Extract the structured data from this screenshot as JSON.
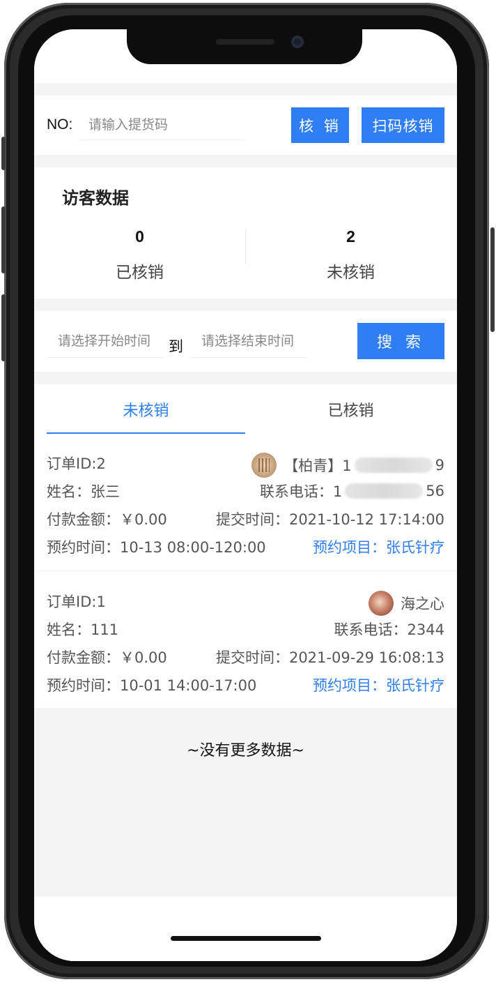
{
  "verify": {
    "no_label": "NO:",
    "code_placeholder": "请输入提货码",
    "verify_button": "核 销",
    "scan_button": "扫码核销"
  },
  "visitor": {
    "title": "访客数据",
    "verified_count": "0",
    "verified_label": "已核销",
    "unverified_count": "2",
    "unverified_label": "未核销"
  },
  "date_filter": {
    "start_placeholder": "请选择开始时间",
    "to_label": "到",
    "end_placeholder": "请选择结束时间",
    "search_button": "搜 索"
  },
  "tabs": {
    "unverified": "未核销",
    "verified": "已核销",
    "active": "unverified"
  },
  "orders": [
    {
      "order_id": "订单ID:2",
      "user_name": "【柏青】1",
      "user_name_tail": "9",
      "name": "姓名：张三",
      "phone_label": "联系电话：1",
      "phone_tail": "56",
      "amount": "付款金额：￥0.00",
      "submit_time": "提交时间：2021-10-12 17:14:00",
      "booking_time": "预约时间：10-13 08:00-120:00",
      "booking_item": "预约项目：张氏针疗"
    },
    {
      "order_id": "订单ID:1",
      "user_name": "海之心",
      "name": "姓名：111",
      "phone": "联系电话：2344",
      "amount": "付款金额：￥0.00",
      "submit_time": "提交时间：2021-09-29 16:08:13",
      "booking_time": "预约时间：10-01 14:00-17:00",
      "booking_item": "预约项目：张氏针疗"
    }
  ],
  "footer": "~没有更多数据~",
  "colors": {
    "accent": "#2f7ef4",
    "background": "#f4f4f4"
  }
}
